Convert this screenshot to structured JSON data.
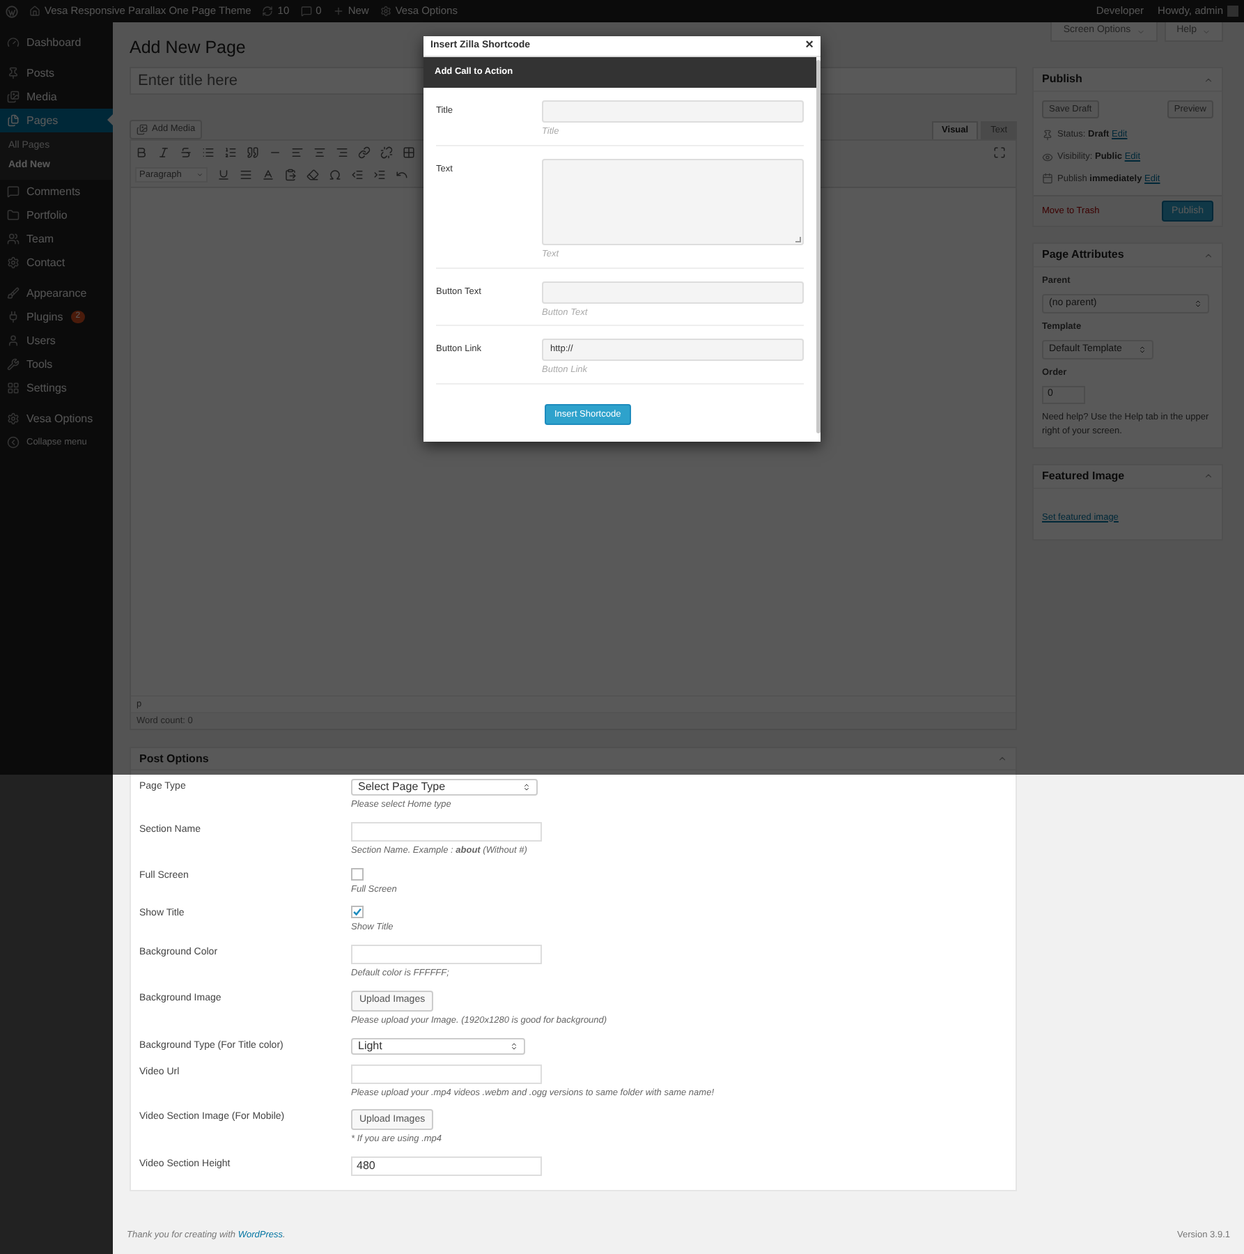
{
  "admin_bar": {
    "site_name": "Vesa Responsive Parallax One Page Theme",
    "updates": "10",
    "comments": "0",
    "new": "New",
    "theme_options": "Vesa Options",
    "user_role": "Developer",
    "greeting": "Howdy, admin"
  },
  "sidebar": {
    "groups": [
      [
        {
          "label": "Dashboard",
          "selected": false
        }
      ],
      [
        {
          "label": "Posts",
          "selected": false
        },
        {
          "label": "Media",
          "selected": false
        },
        {
          "label": "Pages",
          "selected": true,
          "children": [
            {
              "label": "All Pages",
              "selected": false
            },
            {
              "label": "Add New",
              "selected": true
            }
          ]
        },
        {
          "label": "Comments",
          "selected": false
        },
        {
          "label": "Portfolio",
          "selected": false
        },
        {
          "label": "Team",
          "selected": false
        },
        {
          "label": "Contact",
          "selected": false
        }
      ],
      [
        {
          "label": "Appearance",
          "selected": false
        },
        {
          "label": "Plugins",
          "selected": false,
          "badge": "2"
        },
        {
          "label": "Users",
          "selected": false
        },
        {
          "label": "Tools",
          "selected": false
        },
        {
          "label": "Settings",
          "selected": false
        }
      ],
      [
        {
          "label": "Vesa Options",
          "selected": false
        }
      ]
    ],
    "collapse": "Collapse menu"
  },
  "screen_tabs": [
    "Screen Options",
    "Help"
  ],
  "page_title": "Add New Page",
  "title_field": {
    "placeholder": "Enter title here"
  },
  "editor": {
    "add_media": "Add Media",
    "tabs": [
      {
        "label": "Visual",
        "selected": true
      },
      {
        "label": "Text",
        "selected": false
      }
    ],
    "format": "Paragraph",
    "path": "p",
    "word_count": "Word count: 0"
  },
  "post_options": {
    "title": "Post Options",
    "fields": [
      {
        "kind": "select",
        "label": "Page Type",
        "value": "Select Page Type",
        "hint": "Please select Home type"
      },
      {
        "kind": "text",
        "label": "Section Name",
        "hint": "Section Name. Example : **about** (Without #)"
      },
      {
        "kind": "checkbox",
        "label": "Full Screen",
        "checked": false,
        "hint": "Full Screen"
      },
      {
        "kind": "checkbox",
        "label": "Show Title",
        "checked": true,
        "hint": "Show Title"
      },
      {
        "kind": "text",
        "label": "Background Color",
        "hint": "Default color is FFFFFF;"
      },
      {
        "kind": "upload",
        "label": "Background Image",
        "button": "Upload Images",
        "hint": "Please upload your Image. (1920x1280 is good for background)"
      },
      {
        "kind": "select",
        "label": "Background Type (For Title color)",
        "value": "Light"
      },
      {
        "kind": "text",
        "label": "Video Url",
        "hint": "Please upload your .mp4 videos .webm and .ogg versions to same folder with same name!"
      },
      {
        "kind": "upload",
        "label": "Video Section Image (For Mobile)",
        "button": "Upload Images",
        "hint": "* If you are using .mp4"
      },
      {
        "kind": "text",
        "label": "Video Section Height",
        "value": "480"
      }
    ]
  },
  "publish": {
    "title": "Publish",
    "save_draft": "Save Draft",
    "preview": "Preview",
    "rows": [
      {
        "kind": "status",
        "label": "Status:",
        "value": "Draft",
        "link": "Edit"
      },
      {
        "kind": "visibility",
        "label": "Visibility:",
        "value": "Public",
        "link": "Edit"
      },
      {
        "kind": "schedule",
        "label": "Publish",
        "value": "immediately",
        "link": "Edit"
      }
    ],
    "trash": "Move to Trash",
    "publish_button": "Publish"
  },
  "page_attributes": {
    "title": "Page Attributes",
    "parent_label": "Parent",
    "parent": "(no parent)",
    "template_label": "Template",
    "template": "Default Template",
    "order_label": "Order",
    "order": "0",
    "help": "Need help? Use the Help tab in the upper right of your screen."
  },
  "featured_image": {
    "title": "Featured Image",
    "link": "Set featured image"
  },
  "footer": {
    "thanks": "Thank you for creating with",
    "link": "WordPress",
    "after": ".",
    "version": "Version 3.9.1"
  },
  "modal": {
    "title": "Insert Zilla Shortcode",
    "close": "×",
    "header": "Add Call to Action",
    "fields": [
      {
        "kind": "input",
        "label": "Title",
        "hint": "Title"
      },
      {
        "kind": "textarea",
        "label": "Text",
        "hint": "Text"
      },
      {
        "kind": "input",
        "label": "Button Text",
        "hint": "Button Text"
      },
      {
        "kind": "input",
        "label": "Button Link",
        "value": "http://",
        "hint": "Button Link"
      }
    ],
    "submit": "Insert Shortcode"
  }
}
